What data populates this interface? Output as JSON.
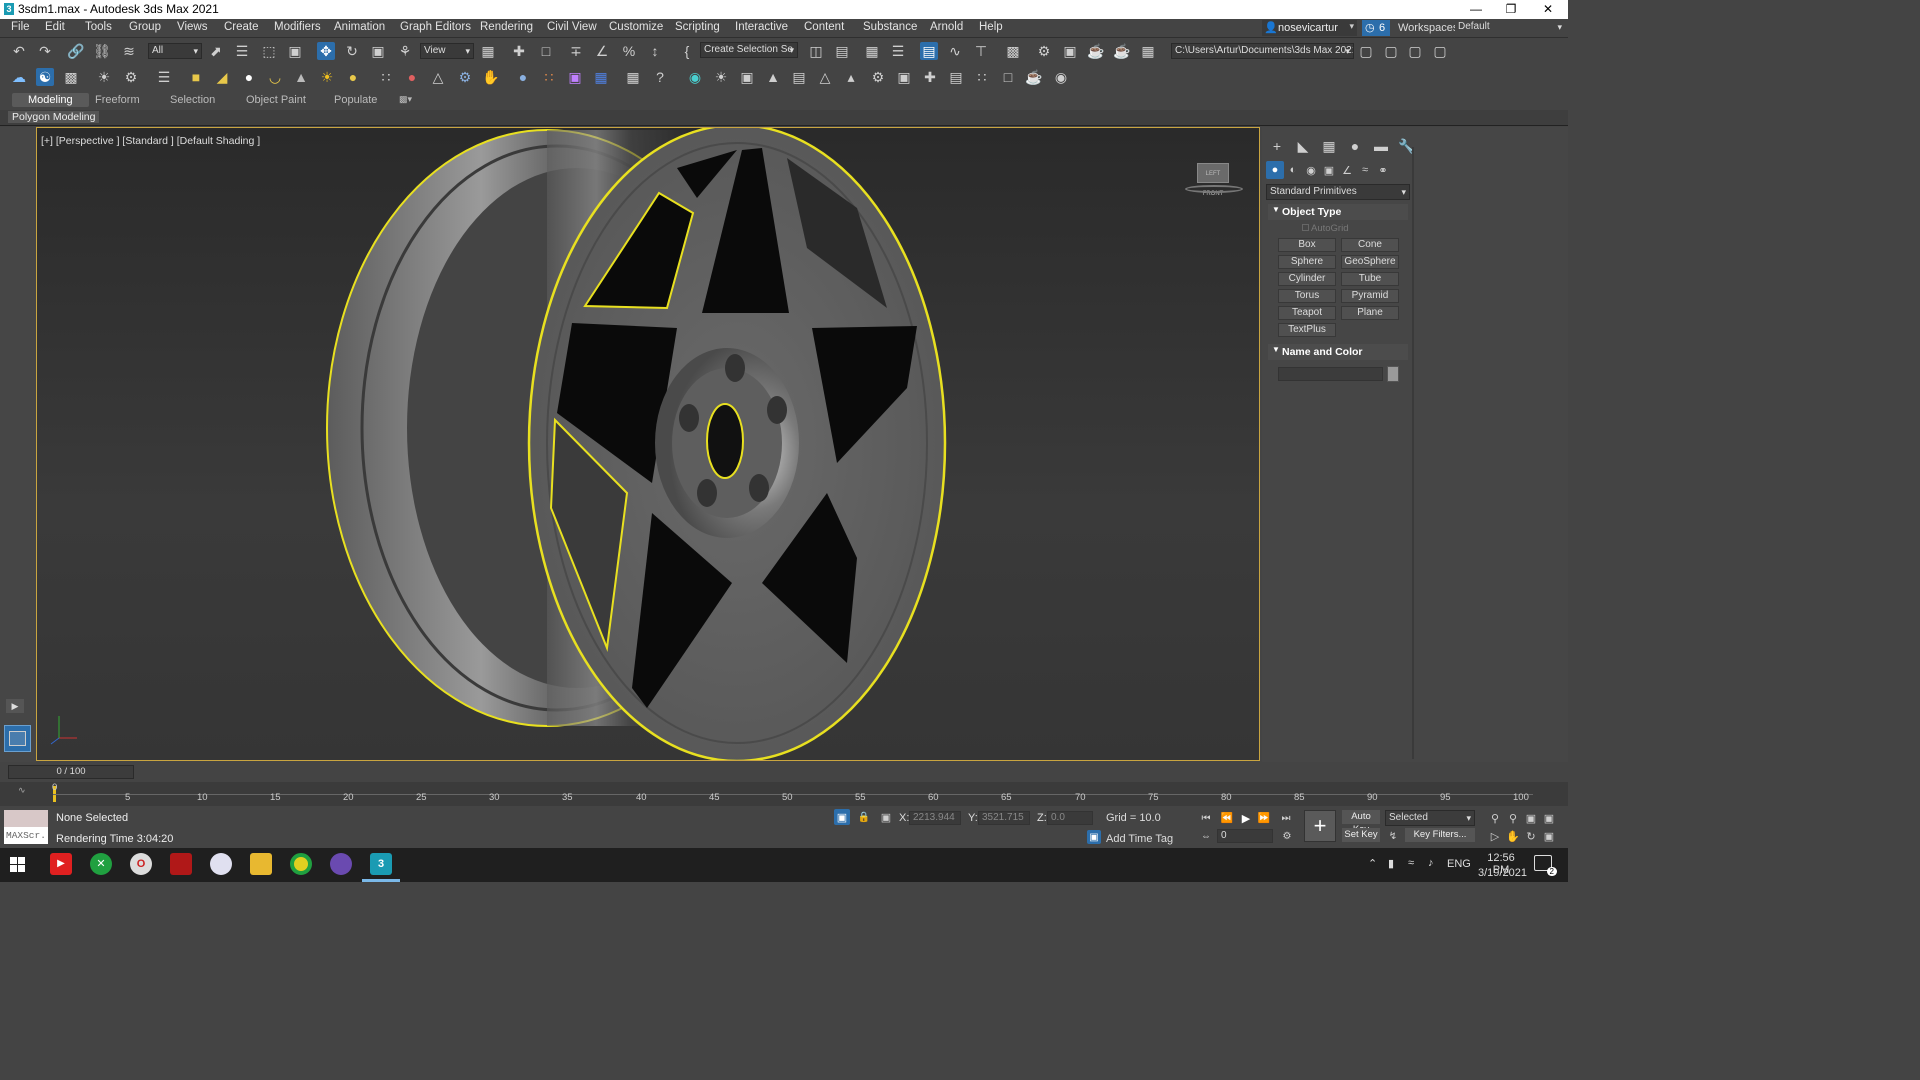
{
  "window": {
    "title": "3sdm1.max - Autodesk 3ds Max 2021"
  },
  "menu": [
    "File",
    "Edit",
    "Tools",
    "Group",
    "Views",
    "Create",
    "Modifiers",
    "Animation",
    "Graph Editors",
    "Rendering",
    "Civil View",
    "Customize",
    "Scripting",
    "Interactive",
    "Content",
    "Substance",
    "Arnold",
    "Help"
  ],
  "account": {
    "user": "nosevicartur",
    "notifications": "6",
    "workspaces_label": "Workspaces:",
    "workspace": "Default"
  },
  "toolbar": {
    "filter_all": "All",
    "ref_coord": "View",
    "selection_set": "Create Selection Se",
    "project_path": "C:\\Users\\Artur\\Documents\\3ds Max 2021"
  },
  "ribbon": {
    "tabs": [
      "Modeling",
      "Freeform",
      "Selection",
      "Object Paint",
      "Populate"
    ],
    "active": "Modeling",
    "sub": "Polygon Modeling"
  },
  "viewport": {
    "label": "[+] [Perspective ] [Standard ] [Default Shading ]",
    "viewcube": "LEFT FRONT"
  },
  "command_panel": {
    "category": "Standard Primitives",
    "object_type_title": "Object Type",
    "autogrid": "AutoGrid",
    "buttons": [
      "Box",
      "Cone",
      "Sphere",
      "GeoSphere",
      "Cylinder",
      "Tube",
      "Torus",
      "Pyramid",
      "Teapot",
      "Plane",
      "TextPlus"
    ],
    "name_color_title": "Name and Color"
  },
  "timeline": {
    "frame": "0 / 100",
    "ticks": [
      "0",
      "5",
      "10",
      "15",
      "20",
      "25",
      "30",
      "35",
      "40",
      "45",
      "50",
      "55",
      "60",
      "65",
      "70",
      "75",
      "80",
      "85",
      "90",
      "95",
      "100"
    ]
  },
  "status": {
    "selection": "None Selected",
    "render_time": "Rendering Time  3:04:20",
    "maxscript": "MAXScr.",
    "x_label": "X:",
    "x": "2213.944",
    "y_label": "Y:",
    "y": "3521.715",
    "z_label": "Z:",
    "z": "0.0",
    "grid": "Grid = 10.0",
    "add_time_tag": "Add Time Tag",
    "auto_key": "Auto Key",
    "set_key": "Set Key",
    "key_mode": "Selected",
    "key_filters": "Key Filters...",
    "current_frame": "0"
  },
  "taskbar": {
    "lang": "ENG",
    "time": "12:56 PM",
    "date": "3/19/2021",
    "notif_count": "2"
  },
  "colors": {
    "selection": "#e8e020",
    "accent": "#2c6eab"
  }
}
